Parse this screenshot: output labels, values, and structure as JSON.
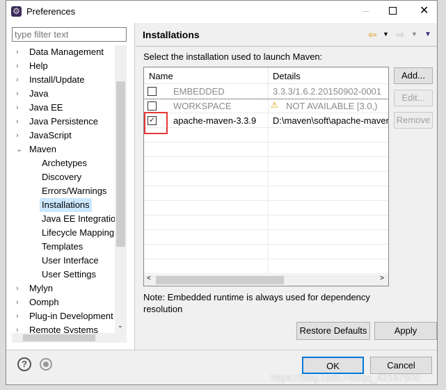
{
  "window": {
    "title": "Preferences",
    "icon": "eclipse-gear-icon"
  },
  "sidebar": {
    "filter_placeholder": "type filter text",
    "items": [
      {
        "label": "Data Management",
        "level": 0,
        "expanded": false
      },
      {
        "label": "Help",
        "level": 0,
        "expanded": false
      },
      {
        "label": "Install/Update",
        "level": 0,
        "expanded": false
      },
      {
        "label": "Java",
        "level": 0,
        "expanded": false
      },
      {
        "label": "Java EE",
        "level": 0,
        "expanded": false
      },
      {
        "label": "Java Persistence",
        "level": 0,
        "expanded": false
      },
      {
        "label": "JavaScript",
        "level": 0,
        "expanded": false
      },
      {
        "label": "Maven",
        "level": 0,
        "expanded": true
      },
      {
        "label": "Archetypes",
        "level": 1
      },
      {
        "label": "Discovery",
        "level": 1
      },
      {
        "label": "Errors/Warnings",
        "level": 1
      },
      {
        "label": "Installations",
        "level": 1,
        "selected": true
      },
      {
        "label": "Java EE Integration",
        "level": 1
      },
      {
        "label": "Lifecycle Mapping",
        "level": 1
      },
      {
        "label": "Templates",
        "level": 1
      },
      {
        "label": "User Interface",
        "level": 1
      },
      {
        "label": "User Settings",
        "level": 1
      },
      {
        "label": "Mylyn",
        "level": 0,
        "expanded": false
      },
      {
        "label": "Oomph",
        "level": 0,
        "expanded": false
      },
      {
        "label": "Plug-in Development",
        "level": 0,
        "expanded": false
      },
      {
        "label": "Remote Systems",
        "level": 0,
        "expanded": false
      }
    ]
  },
  "main": {
    "title": "Installations",
    "instruction": "Select the installation used to launch Maven:",
    "table": {
      "columns": [
        "Name",
        "Details"
      ],
      "rows": [
        {
          "checked": false,
          "name": "EMBEDDED",
          "details": "3.3.3/1.6.2.20150902-0001",
          "disabled": true,
          "warning": false
        },
        {
          "checked": false,
          "name": "WORKSPACE",
          "details": "NOT AVAILABLE [3.0,)",
          "disabled": true,
          "warning": true
        },
        {
          "checked": true,
          "name": "apache-maven-3.3.9",
          "details": "D:\\maven\\soft\\apache-maven",
          "disabled": false,
          "warning": false
        }
      ]
    },
    "buttons": {
      "add": "Add...",
      "edit": "Edit...",
      "remove": "Remove"
    },
    "note": "Note: Embedded runtime is always used for dependency resolution",
    "restore_defaults": "Restore Defaults",
    "apply": "Apply"
  },
  "footer": {
    "ok": "OK",
    "cancel": "Cancel"
  },
  "watermark": "https://blog.csdn.net/qq_42197800",
  "colors": {
    "highlight": "#e53935",
    "selection": "#cce8ff"
  }
}
